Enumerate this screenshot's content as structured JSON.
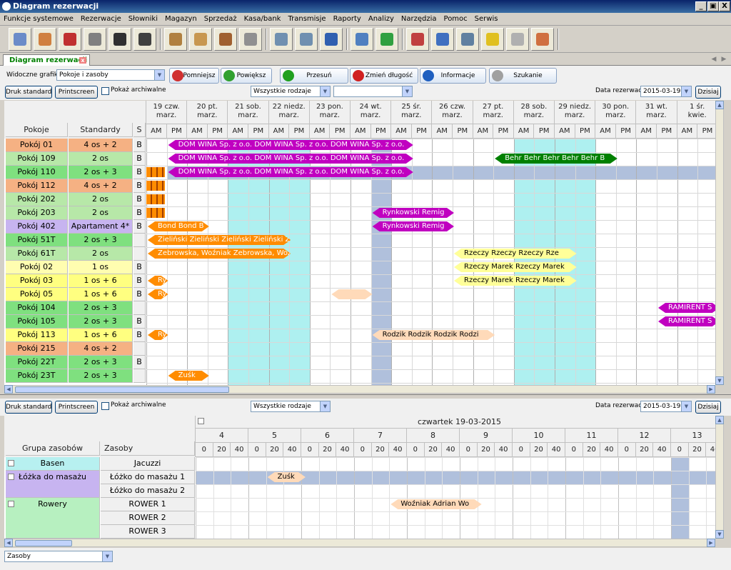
{
  "window": {
    "title": "Diagram rezerwacji",
    "minimize": "_",
    "restore": "▣",
    "close": "X"
  },
  "menu": [
    "Funkcje systemowe",
    "Rezerwacje",
    "Słowniki",
    "Magazyn",
    "Sprzedaż",
    "Kasa/bank",
    "Transmisje",
    "Raporty",
    "Analizy",
    "Narzędzia",
    "Pomoc",
    "Serwis"
  ],
  "toolbar_icons": [
    {
      "name": "grid-calendar-icon",
      "color": "#6b8cc8"
    },
    {
      "name": "chart-icon",
      "color": "#d08040"
    },
    {
      "name": "magnet-icon",
      "color": "#c03030"
    },
    {
      "name": "printer-icon",
      "color": "#808080"
    },
    {
      "name": "clapper-icon",
      "color": "#303030"
    },
    {
      "name": "flag-icon",
      "color": "#404040"
    },
    {
      "name": "box-icon",
      "color": "#b08040"
    },
    {
      "name": "boxes-icon",
      "color": "#c89850"
    },
    {
      "name": "user-box-icon",
      "color": "#a06030"
    },
    {
      "name": "gears-icon",
      "color": "#909090"
    },
    {
      "name": "network-icon",
      "color": "#7090b0"
    },
    {
      "name": "network-settings-icon",
      "color": "#7090b0"
    },
    {
      "name": "user-network-icon",
      "color": "#3060b0"
    },
    {
      "name": "tools-icon",
      "color": "#5080c0"
    },
    {
      "name": "globe-icon",
      "color": "#30a040"
    },
    {
      "name": "user-minus-icon",
      "color": "#c04040"
    },
    {
      "name": "info-card-icon",
      "color": "#4070c0"
    },
    {
      "name": "keyboard-icon",
      "color": "#6080a0"
    },
    {
      "name": "sun-icon",
      "color": "#e0c020"
    },
    {
      "name": "document-icon",
      "color": "#b0b0b0"
    },
    {
      "name": "notepad-icon",
      "color": "#d07040"
    }
  ],
  "tab": {
    "label": "Diagram rezerwacji",
    "close": "x"
  },
  "upper": {
    "visible_label": "Widoczne grafiki",
    "visible_value": "Pokoje i zasoby",
    "buttons": [
      "Pomniejsz",
      "Powiększ",
      "Przesuń",
      "Zmień długość",
      "Informacje",
      "Szukanie"
    ],
    "print_std": "Druk standard",
    "printscreen": "Printscreen",
    "archive": "Pokaż archiwalne",
    "filter1": "Wszystkie rodzaje",
    "filter2": "",
    "date_label": "Data rezerwacji",
    "date_value": "2015-03-19",
    "today": "Dzisiaj",
    "col_rooms": "Pokoje",
    "col_std": "Standardy",
    "col_s": "S",
    "days": [
      {
        "d": "19 czw.",
        "m": "marz."
      },
      {
        "d": "20 pt.",
        "m": "marz."
      },
      {
        "d": "21 sob.",
        "m": "marz."
      },
      {
        "d": "22 niedz.",
        "m": "marz."
      },
      {
        "d": "23 pon.",
        "m": "marz."
      },
      {
        "d": "24 wt.",
        "m": "marz."
      },
      {
        "d": "25 śr.",
        "m": "marz."
      },
      {
        "d": "26 czw.",
        "m": "marz."
      },
      {
        "d": "27 pt.",
        "m": "marz."
      },
      {
        "d": "28 sob.",
        "m": "marz."
      },
      {
        "d": "29 niedz.",
        "m": "marz."
      },
      {
        "d": "30 pon.",
        "m": "marz."
      },
      {
        "d": "31 wt.",
        "m": "marz."
      },
      {
        "d": "1 śr.",
        "m": "kwie."
      }
    ],
    "ampm": [
      "AM",
      "PM"
    ],
    "rows": [
      {
        "room": "Pokój 01",
        "std": "4 os + 2",
        "s": "B",
        "color": "#f5b183"
      },
      {
        "room": "Pokój 109",
        "std": "2 os",
        "s": "B",
        "color": "#b7e8a8"
      },
      {
        "room": "Pokój 110",
        "std": "2 os + 3",
        "s": "B",
        "color": "#7fe07f"
      },
      {
        "room": "Pokój 112",
        "std": "4 os + 2",
        "s": "B",
        "color": "#f5b183"
      },
      {
        "room": "Pokój 202",
        "std": "2 os",
        "s": "B",
        "color": "#b7e8a8"
      },
      {
        "room": "Pokój 203",
        "std": "2 os",
        "s": "B",
        "color": "#b7e8a8"
      },
      {
        "room": "Pokój 402",
        "std": "Apartament 4*",
        "s": "B",
        "color": "#c7b4f0"
      },
      {
        "room": "Pokój 51T",
        "std": "2 os + 3",
        "s": "",
        "color": "#7fe07f"
      },
      {
        "room": "Pokój 61T",
        "std": "2 os",
        "s": "",
        "color": "#b7e8a8"
      },
      {
        "room": "Pokój 02",
        "std": "1 os",
        "s": "B",
        "color": "#fffdb0"
      },
      {
        "room": "Pokój 03",
        "std": "1 os + 6",
        "s": "B",
        "color": "#ffff80"
      },
      {
        "room": "Pokój 05",
        "std": "1 os + 6",
        "s": "B",
        "color": "#ffff80"
      },
      {
        "room": "Pokój 104",
        "std": "2 os + 3",
        "s": "",
        "color": "#7fe07f"
      },
      {
        "room": "Pokój 105",
        "std": "2 os + 3",
        "s": "B",
        "color": "#7fe07f"
      },
      {
        "room": "Pokój 113",
        "std": "1 os + 6",
        "s": "B",
        "color": "#ffff80"
      },
      {
        "room": "Pokój 215",
        "std": "4 os + 2",
        "s": "",
        "color": "#f5b183"
      },
      {
        "room": "Pokój 22T",
        "std": "2 os + 3",
        "s": "B",
        "color": "#7fe07f"
      },
      {
        "room": "Pokój 23T",
        "std": "2 os + 3",
        "s": "",
        "color": "#7fe07f"
      }
    ],
    "bars": [
      {
        "row": 0,
        "start": 1,
        "end": 13,
        "text": "DOM WINA Sp. z o.o.  DOM WINA Sp. z o.o.  DOM WINA Sp. z o.o.",
        "bg": "#c000c0",
        "fg": "#fff"
      },
      {
        "row": 1,
        "start": 1,
        "end": 13,
        "text": "DOM WINA Sp. z o.o.  DOM WINA Sp. z o.o.  DOM WINA Sp. z o.o.",
        "bg": "#c000c0",
        "fg": "#fff"
      },
      {
        "row": 1,
        "start": 17,
        "end": 23,
        "text": "Behr  Behr  Behr  Behr  Behr  B",
        "bg": "#008000",
        "fg": "#fff"
      },
      {
        "row": 2,
        "start": 1,
        "end": 13,
        "text": "DOM WINA Sp. z o.o.  DOM WINA Sp. z o.o.  DOM WINA Sp. z o.o.",
        "bg": "#c000c0",
        "fg": "#fff"
      },
      {
        "row": 5,
        "start": 11,
        "end": 15,
        "text": "Rynkowski Remig",
        "bg": "#c000c0",
        "fg": "#fff"
      },
      {
        "row": 6,
        "start": 0,
        "end": 3,
        "text": "Bond  Bond  B",
        "bg": "#ff8c00",
        "fg": "#fff"
      },
      {
        "row": 6,
        "start": 11,
        "end": 15,
        "text": "Rynkowski Remig",
        "bg": "#c000c0",
        "fg": "#fff"
      },
      {
        "row": 7,
        "start": 0,
        "end": 7,
        "text": "Zieliński  Zieliński  Zieliński  Zieliński  Zi",
        "bg": "#ff8c00",
        "fg": "#fff"
      },
      {
        "row": 8,
        "start": 0,
        "end": 7,
        "text": "Zebrowska, Woźniak  Zebrowska, Woź",
        "bg": "#ff8c00",
        "fg": "#fff"
      },
      {
        "row": 8,
        "start": 15,
        "end": 21,
        "text": "Rzeczy  Rzeczy  Rzeczy  Rze",
        "bg": "#ffff99",
        "fg": "#000"
      },
      {
        "row": 9,
        "start": 15,
        "end": 21,
        "text": "Rzeczy Marek  Rzeczy Marek",
        "bg": "#ffff99",
        "fg": "#000"
      },
      {
        "row": 10,
        "start": 0,
        "end": 1,
        "text": "Ry",
        "bg": "#ff8c00",
        "fg": "#fff"
      },
      {
        "row": 10,
        "start": 15,
        "end": 21,
        "text": "Rzeczy Marek  Rzeczy Marek",
        "bg": "#ffff99",
        "fg": "#000"
      },
      {
        "row": 11,
        "start": 0,
        "end": 1,
        "text": "Ry",
        "bg": "#ff8c00",
        "fg": "#fff"
      },
      {
        "row": 11,
        "start": 9,
        "end": 11,
        "text": "",
        "bg": "#ffdab9",
        "fg": "#000"
      },
      {
        "row": 12,
        "start": 25,
        "end": 28,
        "text": "RAMIRENT S",
        "bg": "#c000c0",
        "fg": "#fff"
      },
      {
        "row": 13,
        "start": 25,
        "end": 28,
        "text": "RAMIRENT S",
        "bg": "#c000c0",
        "fg": "#fff"
      },
      {
        "row": 14,
        "start": 0,
        "end": 1,
        "text": "Ry",
        "bg": "#ff8c00",
        "fg": "#fff"
      },
      {
        "row": 14,
        "start": 11,
        "end": 17,
        "text": "Rodzik  Rodzik  Rodzik  Rodzi",
        "bg": "#ffdab9",
        "fg": "#000"
      },
      {
        "row": 17,
        "start": 1,
        "end": 3,
        "text": "Zuśk",
        "bg": "#ff8c00",
        "fg": "#fff"
      }
    ]
  },
  "lower": {
    "print_std": "Druk standard",
    "printscreen": "Printscreen",
    "archive": "Pokaż archiwalne",
    "filter1": "Wszystkie rodzaje",
    "date_label": "Data rezerwacji",
    "date_value": "2015-03-19",
    "today": "Dzisiaj",
    "day_header": "czwartek 19-03-2015",
    "hours": [
      "4",
      "5",
      "6",
      "7",
      "8",
      "9",
      "10",
      "11",
      "12",
      "13"
    ],
    "minutes": [
      "0",
      "20",
      "40"
    ],
    "col_group": "Grupa zasobów",
    "col_res": "Zasoby",
    "groups": [
      {
        "name": "Basen",
        "color": "#b7f0f0",
        "rows": 1
      },
      {
        "name": "Łóżka do masażu",
        "color": "#c7b4f0",
        "rows": 2
      },
      {
        "name": "Rowery",
        "color": "#b7f0c0",
        "rows": 3
      }
    ],
    "resources": [
      "Jacuzzi",
      "Łóżko do masażu 1",
      "Łóżko do masażu 2",
      "ROWER 1",
      "ROWER 2",
      "ROWER 3"
    ],
    "bars": [
      {
        "row": 1,
        "start": 4,
        "end": 6,
        "text": "Zuśk",
        "bg": "#ffdab9",
        "fg": "#000"
      },
      {
        "row": 3,
        "start": 11,
        "end": 16,
        "text": "Woźniak Adrian  Wo",
        "bg": "#ffdab9",
        "fg": "#000"
      }
    ],
    "footer_combo": "Zasoby"
  }
}
